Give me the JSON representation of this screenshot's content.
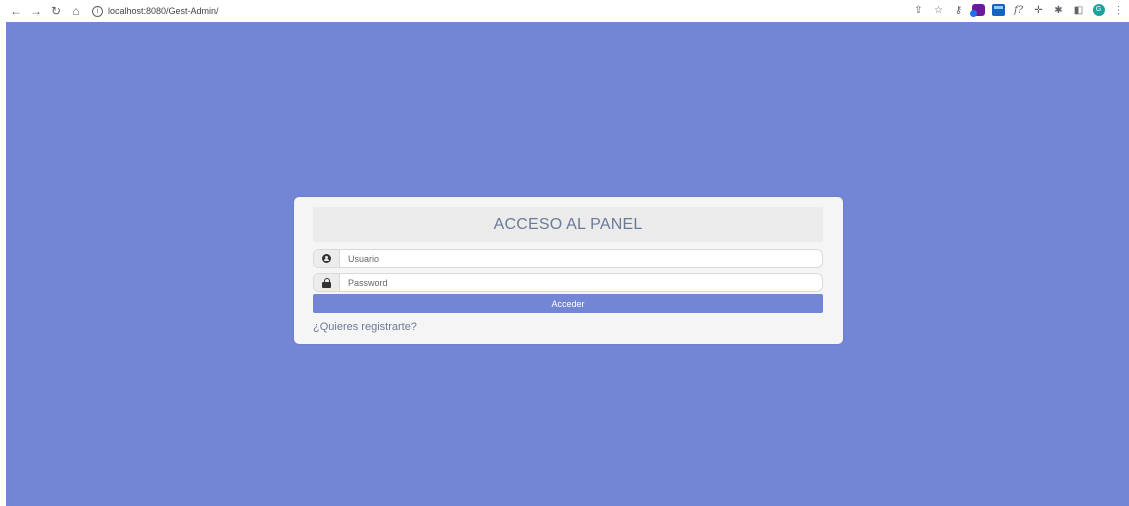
{
  "browser": {
    "url": "localhost:8080/Gest-Admin/",
    "nav_icons": [
      "back-arrow-icon",
      "forward-arrow-icon",
      "reload-icon",
      "home-icon"
    ],
    "profile_initial": "G"
  },
  "login": {
    "title": "ACCESO AL PANEL",
    "username_placeholder": "Usuario",
    "password_placeholder": "Password",
    "submit_label": "Acceder",
    "register_link": "¿Quieres registrarte?"
  },
  "colors": {
    "background": "#7386d5",
    "panel": "#f5f5f5",
    "header": "#ebebeb",
    "accent": "#7386d5",
    "title_text": "#6b7a99"
  }
}
